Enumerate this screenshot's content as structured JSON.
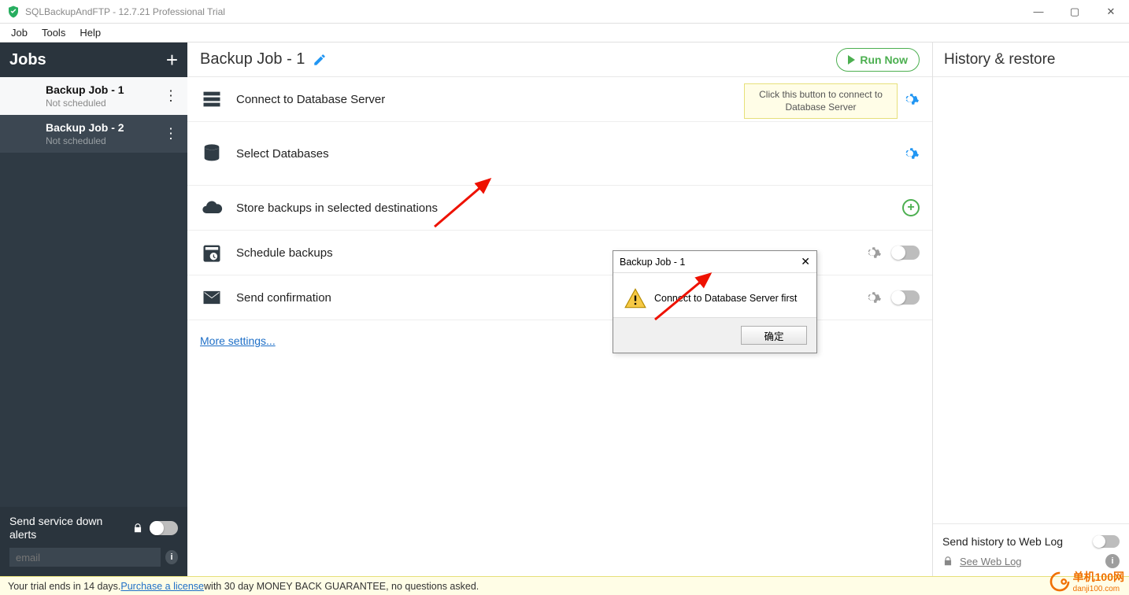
{
  "window": {
    "title": "SQLBackupAndFTP - 12.7.21 Professional Trial"
  },
  "menu": {
    "items": [
      "Job",
      "Tools",
      "Help"
    ]
  },
  "sidebar": {
    "title": "Jobs",
    "jobs": [
      {
        "name": "Backup Job - 1",
        "status": "Not scheduled",
        "active": false
      },
      {
        "name": "Backup Job - 2",
        "status": "Not scheduled",
        "active": true
      }
    ],
    "alerts_label": "Send service down alerts",
    "email_placeholder": "email"
  },
  "main": {
    "title": "Backup Job - 1",
    "run_button": "Run Now",
    "tooltip": "Click this button to connect to Database Server",
    "steps": {
      "connect": "Connect to Database Server",
      "select": "Select Databases",
      "store": "Store backups in selected destinations",
      "schedule": "Schedule backups",
      "confirm": "Send confirmation"
    },
    "more_settings": "More settings..."
  },
  "right": {
    "title": "History & restore",
    "weblog_label": "Send history to Web Log",
    "see_weblog": "See Web Log"
  },
  "dialog": {
    "title": "Backup Job - 1",
    "message": "Connect to Database Server first",
    "ok": "确定"
  },
  "bottombar": {
    "text1": "Your trial ends in 14 days.  ",
    "link": "Purchase a license",
    "text2": " with 30 day MONEY BACK GUARANTEE, no questions asked."
  },
  "watermark": {
    "line1": "单机100网",
    "line2": "danji100.com"
  }
}
